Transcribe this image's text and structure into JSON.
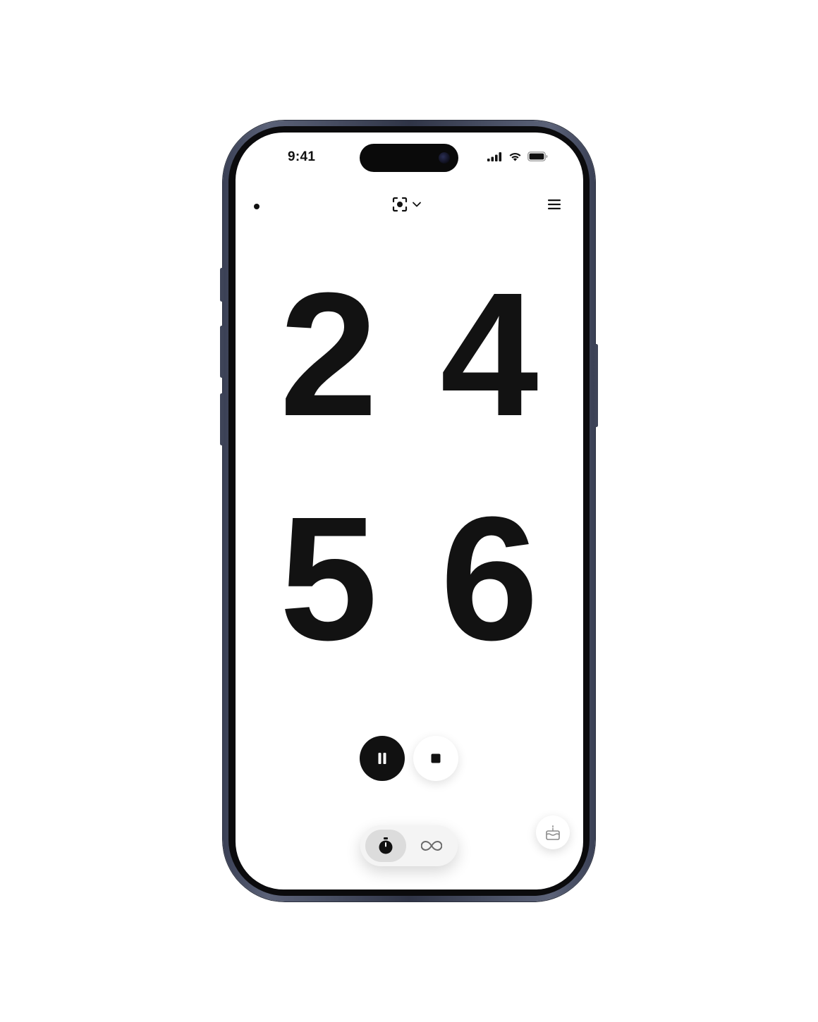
{
  "status_bar": {
    "time": "9:41",
    "icons": [
      "cellular-signal-icon",
      "wifi-icon",
      "battery-icon"
    ]
  },
  "top_bar": {
    "left_indicator": "dot-indicator",
    "mode_icon": "focus-camera-icon",
    "mode_dropdown_icon": "chevron-down-icon",
    "menu_icon": "hamburger-menu-icon"
  },
  "timer": {
    "digits": [
      "2",
      "4",
      "5",
      "6"
    ]
  },
  "controls": {
    "pause_icon": "pause-icon",
    "stop_icon": "stop-icon"
  },
  "mode_switch": {
    "options": [
      "stopwatch-icon",
      "infinity-icon"
    ],
    "selected": "stopwatch-icon"
  },
  "floating_action": {
    "icon": "cake-icon"
  },
  "colors": {
    "background": "#ffffff",
    "digit": "#121212",
    "frame": "#3a4055",
    "segment_selected": "#dcdcdc"
  }
}
